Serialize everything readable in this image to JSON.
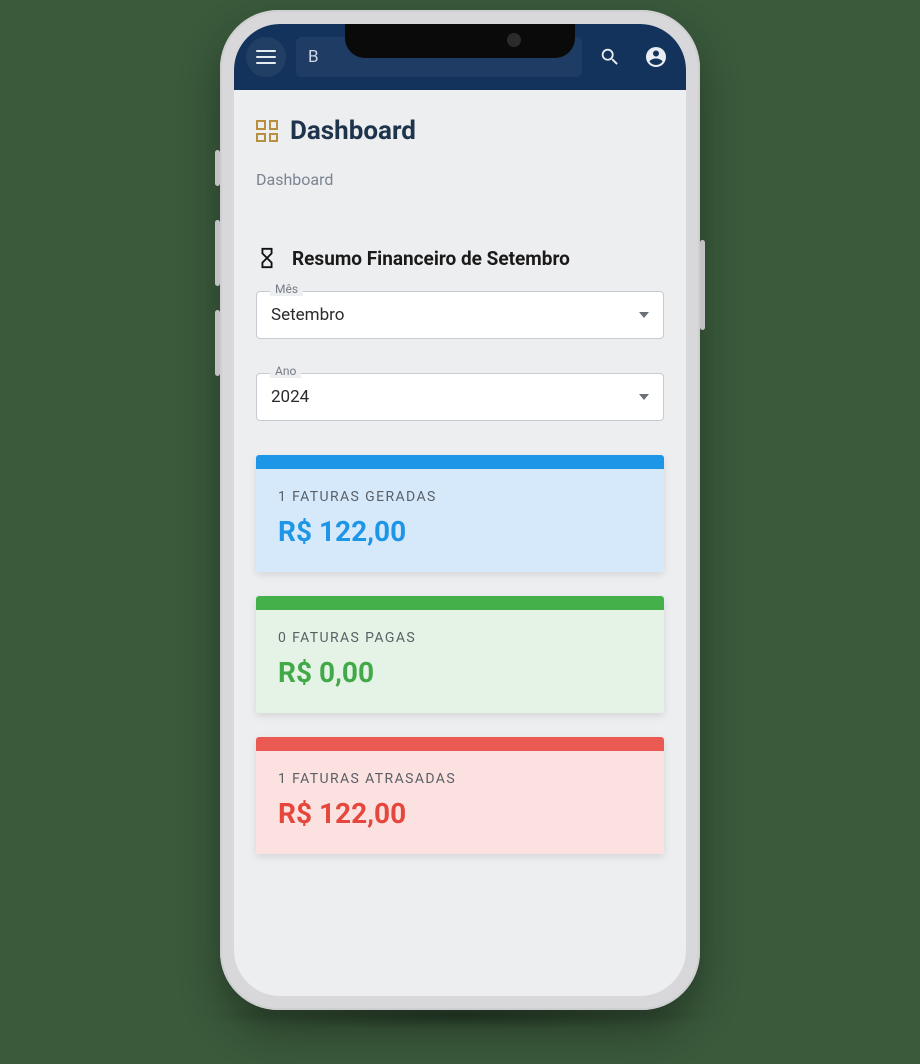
{
  "header": {
    "search_placeholder": "B"
  },
  "page": {
    "title": "Dashboard",
    "breadcrumb": "Dashboard"
  },
  "summary": {
    "heading": "Resumo Financeiro de Setembro",
    "month_label": "Mês",
    "month_value": "Setembro",
    "year_label": "Ano",
    "year_value": "2024"
  },
  "cards": {
    "generated": {
      "label": "1 FATURAS GERADAS",
      "value": "R$ 122,00",
      "color": "#1e96e8"
    },
    "paid": {
      "label": "0 FATURAS PAGAS",
      "value": "R$ 0,00",
      "color": "#43b04a"
    },
    "overdue": {
      "label": "1 FATURAS ATRASADAS",
      "value": "R$ 122,00",
      "color": "#ea5a52"
    }
  }
}
